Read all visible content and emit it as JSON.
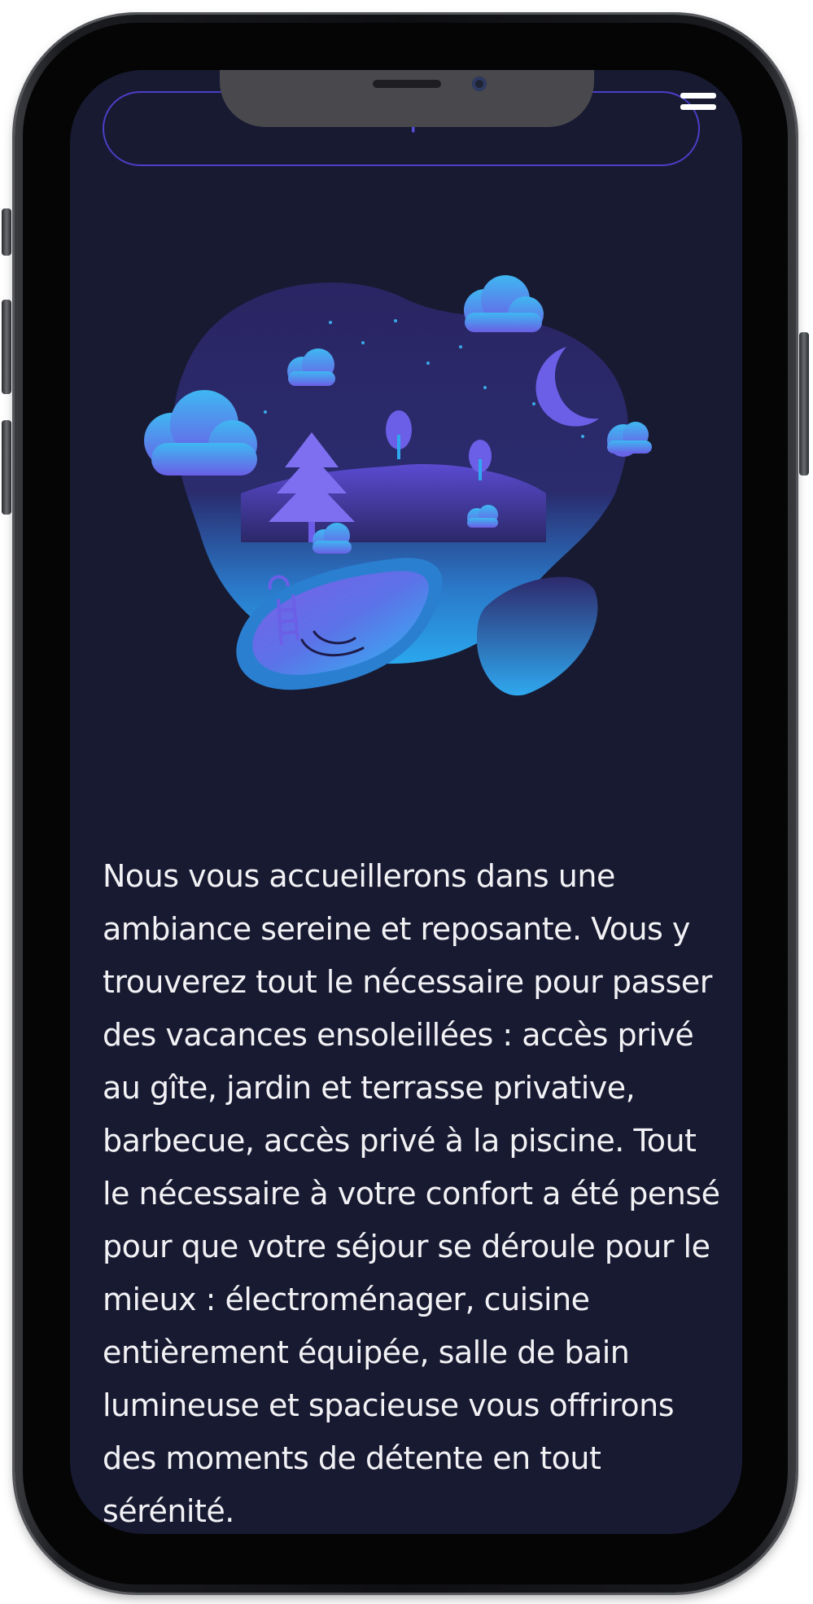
{
  "header": {
    "photos_button_label": "Voir les photos",
    "menu_icon": "hamburger-menu-icon"
  },
  "illustration": {
    "description_icon": "night-pool-illustration",
    "colors": {
      "background": "#181a32",
      "accent_purple": "#6c5ce7",
      "accent_blue": "#2fa8ef",
      "button_border": "#4a3fc6"
    }
  },
  "content": {
    "description": "Nous vous accueillerons dans une ambiance sereine et reposante. Vous y trouverez tout le nécessaire pour passer des vacances ensoleillées : accès privé au gîte, jardin et terrasse privative, barbecue, accès privé à la piscine. Tout le nécessaire à votre confort a été pensé pour que votre séjour se déroule pour le mieux : électroménager, cuisine entièrement équipée, salle de bain lumineuse et spacieuse vous offrirons des moments de détente en tout sérénité."
  }
}
